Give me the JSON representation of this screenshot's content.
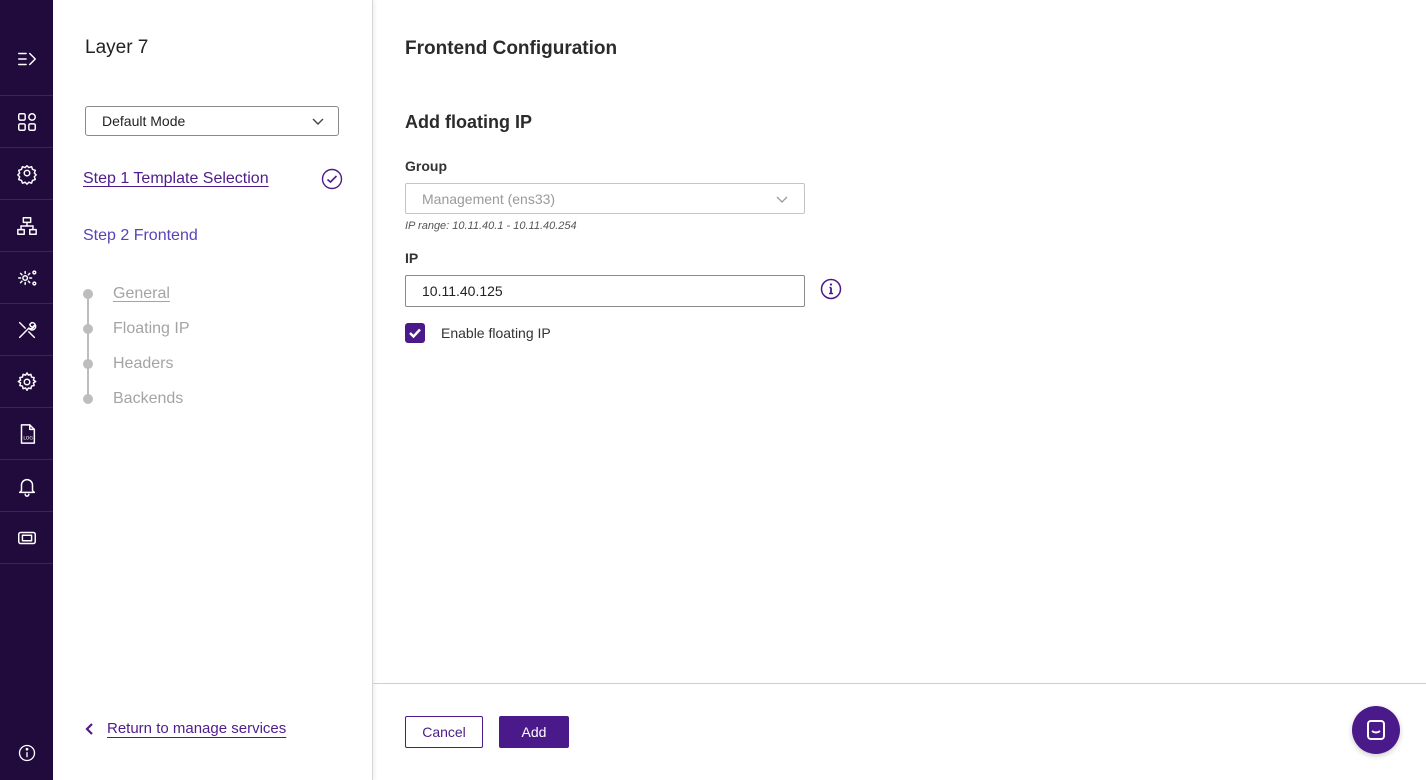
{
  "rail": {
    "items": [
      {
        "icon": "expand-menu-icon"
      },
      {
        "icon": "dashboard-grid-icon"
      },
      {
        "icon": "location-gear-icon"
      },
      {
        "icon": "network-icon"
      },
      {
        "icon": "settings-network-icon"
      },
      {
        "icon": "tools-icon"
      },
      {
        "icon": "gear-icon"
      },
      {
        "icon": "log-file-icon"
      },
      {
        "icon": "bell-icon"
      },
      {
        "icon": "ticket-icon"
      }
    ],
    "bottom_icon": "info-icon"
  },
  "steps": {
    "title": "Layer 7",
    "mode": "Default Mode",
    "step1": "Step 1 Template Selection",
    "step2": "Step 2 Frontend",
    "substeps": [
      {
        "label": "General"
      },
      {
        "label": "Floating IP"
      },
      {
        "label": "Headers"
      },
      {
        "label": "Backends"
      }
    ],
    "return_label": "Return to manage services"
  },
  "main": {
    "title": "Frontend Configuration",
    "section_title": "Add floating IP",
    "group_label": "Group",
    "group_value": "Management (ens33)",
    "ip_range_hint": "IP range: 10.11.40.1 - 10.11.40.254",
    "ip_label": "IP",
    "ip_value": "10.11.40.125",
    "enable_label": "Enable floating IP",
    "enable_checked": true,
    "cancel_label": "Cancel",
    "add_label": "Add"
  },
  "colors": {
    "rail_bg": "#210b3d",
    "accent": "#4b1a8a",
    "step2_text": "#5a43b8"
  }
}
